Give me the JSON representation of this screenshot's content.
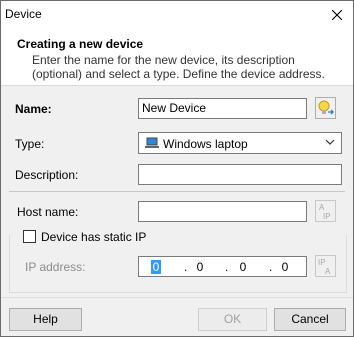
{
  "window": {
    "title": "Device"
  },
  "header": {
    "title": "Creating a new device",
    "description": "Enter the name for the new device, its description (optional) and select a type. Define the device address."
  },
  "form": {
    "name_label": "Name:",
    "name_value": "New Device",
    "type_label": "Type:",
    "type_value": "Windows laptop",
    "description_label": "Description:",
    "description_value": "",
    "hostname_label": "Host name:",
    "hostname_value": "",
    "static_ip_label": "Device has static IP",
    "static_ip_checked": false,
    "ip_label": "IP address:",
    "ip_octets": [
      "0",
      "0",
      "0",
      "0"
    ]
  },
  "footer": {
    "help_label": "Help",
    "ok_label": "OK",
    "cancel_label": "Cancel"
  },
  "colors": {
    "accent": "#0078d7",
    "selection": "#3399ff",
    "disabled_text": "#8c8c8c"
  }
}
